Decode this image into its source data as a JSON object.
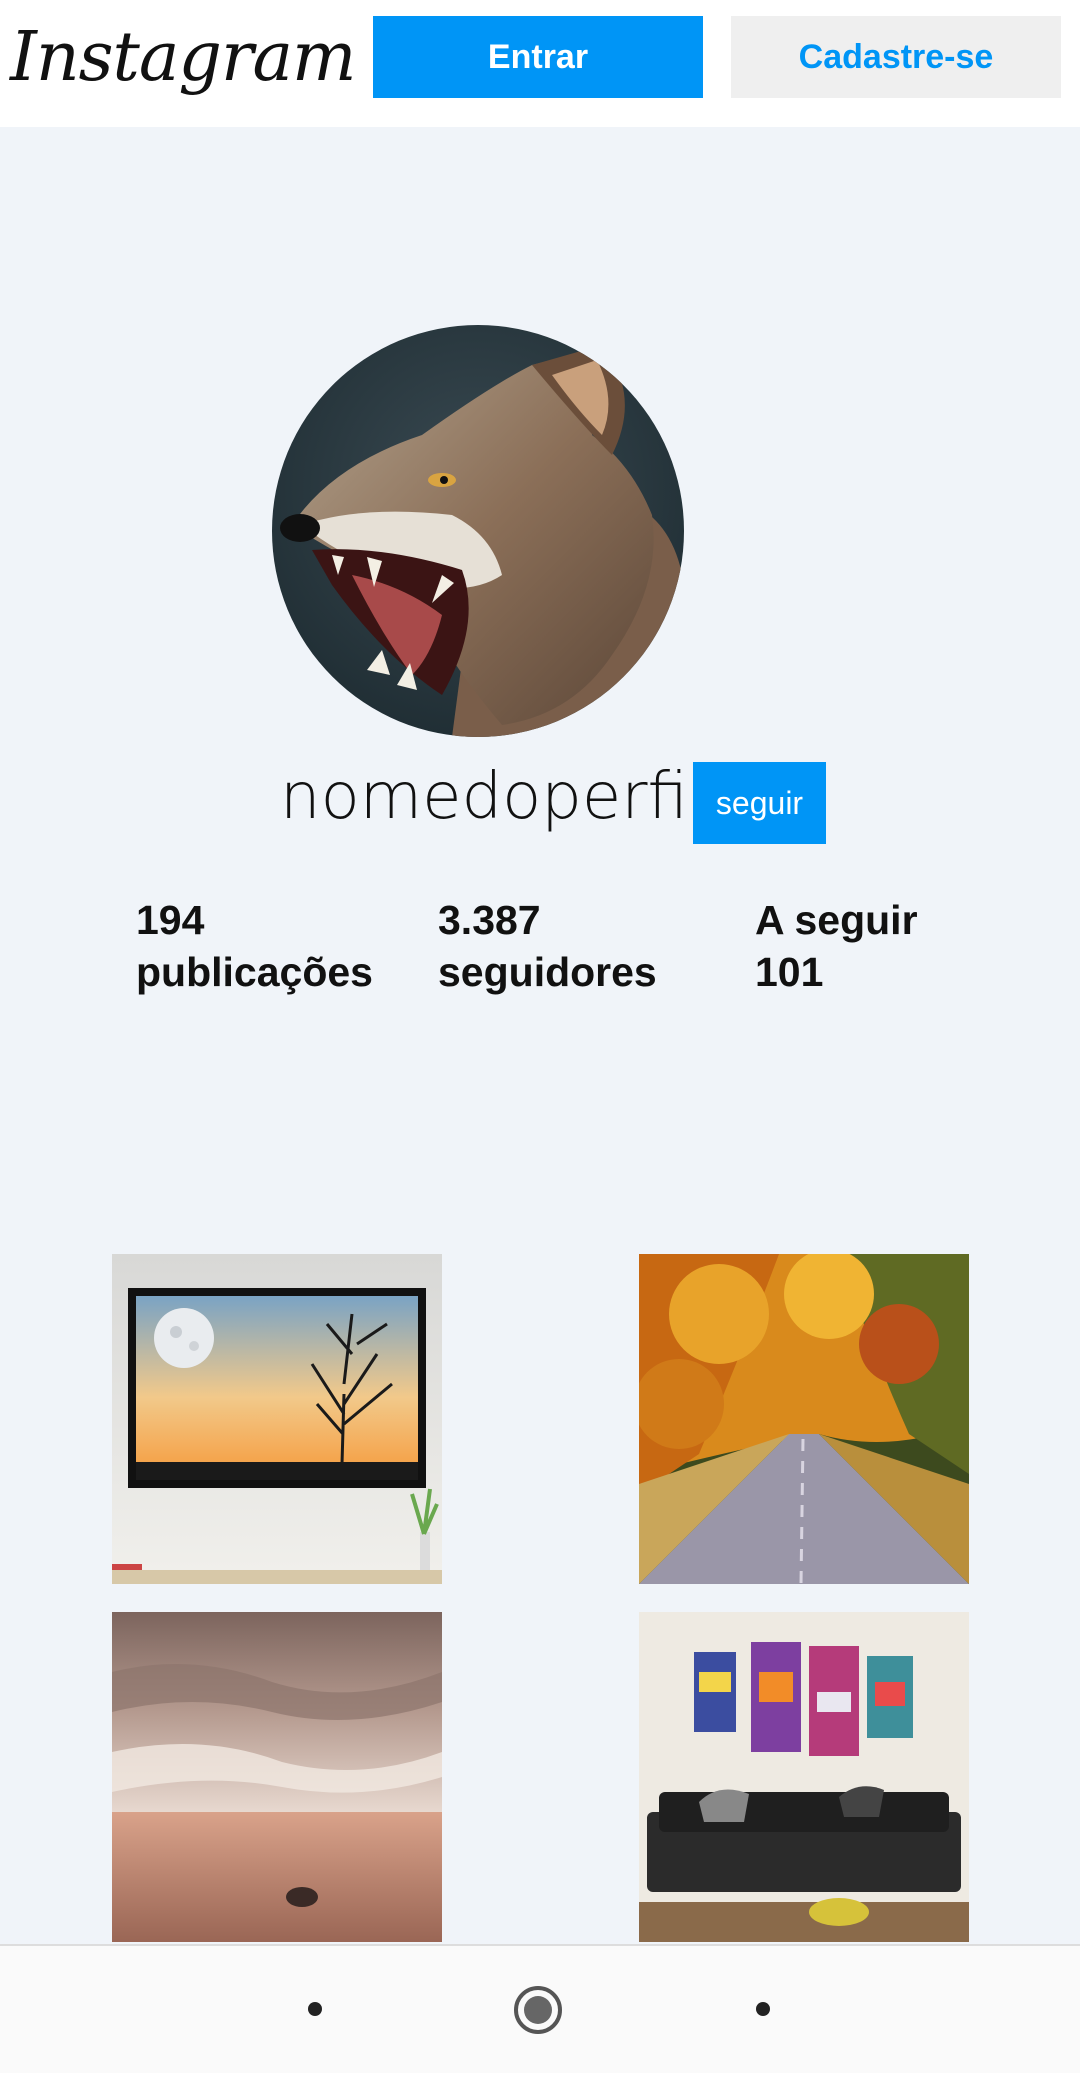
{
  "header": {
    "logo_text": "Instagram",
    "login_label": "Entrar",
    "signup_label": "Cadastre-se"
  },
  "profile": {
    "username": "nomedoperfil",
    "follow_label": "seguir",
    "stats": {
      "posts_count": "194",
      "posts_label": "publicações",
      "followers_count": "3.387",
      "followers_label": "seguidores",
      "following_label": "A seguir",
      "following_count": "101"
    }
  },
  "colors": {
    "accent": "#0095f6",
    "page_background": "#f0f4f9",
    "secondary_button": "#efefef"
  },
  "posts": [
    {
      "subject": "framed-moon-tree-art"
    },
    {
      "subject": "autumn-tree-road"
    },
    {
      "subject": "cloudy-seascape"
    },
    {
      "subject": "living-room-canvas-sofa"
    }
  ],
  "bottom_nav": {
    "icons": [
      "nav-dot-icon",
      "home-circle-icon",
      "nav-dot-icon"
    ]
  }
}
